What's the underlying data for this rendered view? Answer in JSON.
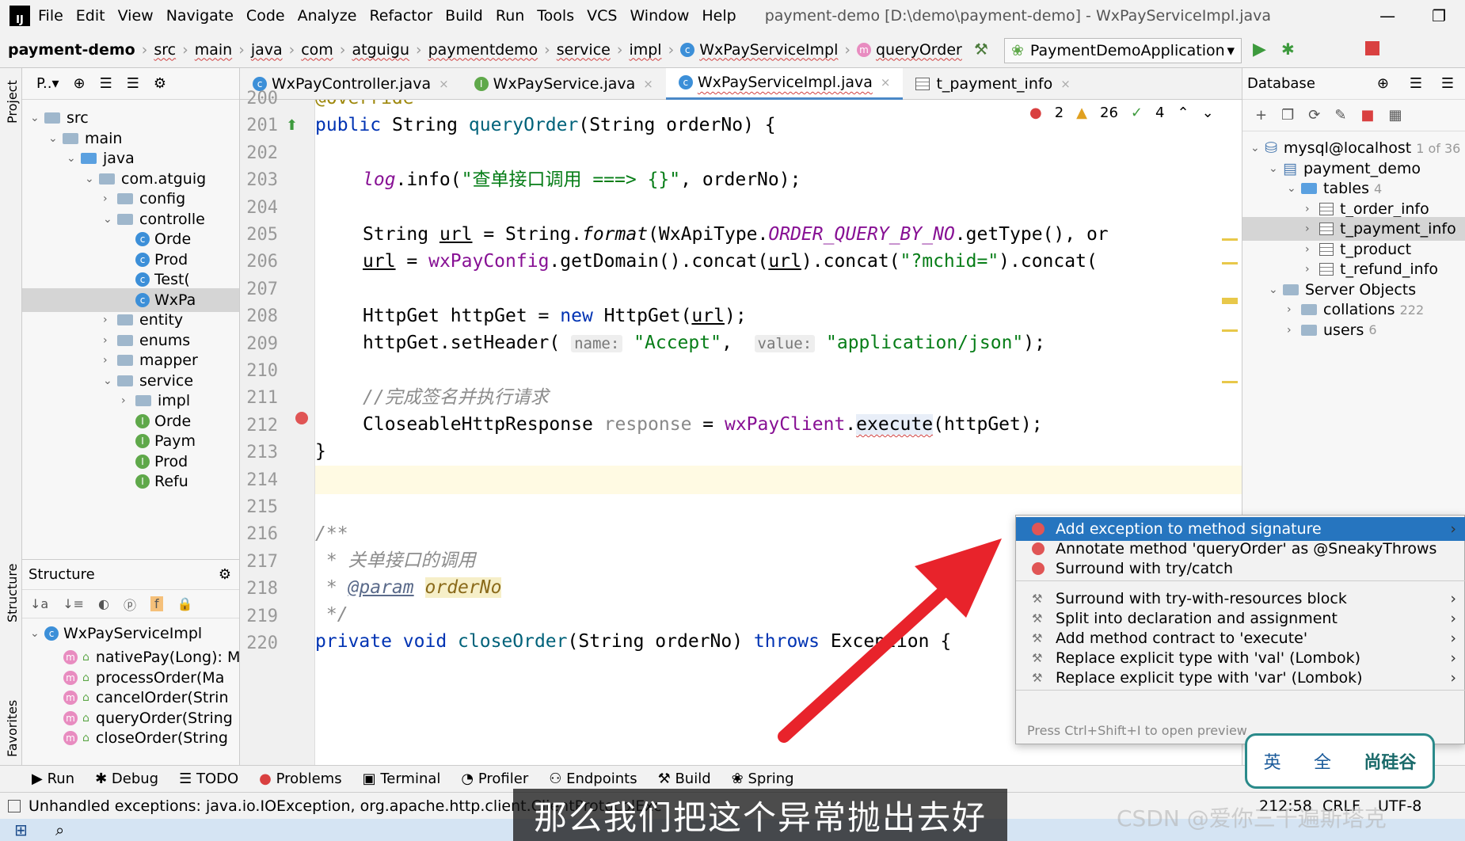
{
  "menu": {
    "items": [
      "File",
      "Edit",
      "View",
      "Navigate",
      "Code",
      "Analyze",
      "Refactor",
      "Build",
      "Run",
      "Tools",
      "VCS",
      "Window",
      "Help"
    ],
    "window_title": "payment-demo [D:\\demo\\payment-demo] - WxPayServiceImpl.java"
  },
  "navbar": {
    "crumbs": [
      "payment-demo",
      "src",
      "main",
      "java",
      "com",
      "atguigu",
      "paymentdemo",
      "service",
      "impl",
      "WxPayServiceImpl",
      "queryOrder"
    ],
    "run_config": "PaymentDemoApplication"
  },
  "project": {
    "header": "P..▾",
    "rows": [
      {
        "label": "src",
        "indent": 1,
        "chev": "⌄",
        "kind": "folder"
      },
      {
        "label": "main",
        "indent": 2,
        "chev": "⌄",
        "kind": "folder"
      },
      {
        "label": "java",
        "indent": 3,
        "chev": "⌄",
        "kind": "folder-blue"
      },
      {
        "label": "com.atguig",
        "indent": 4,
        "chev": "⌄",
        "kind": "folder"
      },
      {
        "label": "config",
        "indent": 5,
        "chev": "›",
        "kind": "folder"
      },
      {
        "label": "controlle",
        "indent": 5,
        "chev": "⌄",
        "kind": "folder"
      },
      {
        "label": "Orde",
        "indent": 6,
        "chev": "",
        "kind": "c"
      },
      {
        "label": "Prod",
        "indent": 6,
        "chev": "",
        "kind": "c"
      },
      {
        "label": "Test(",
        "indent": 6,
        "chev": "",
        "kind": "c"
      },
      {
        "label": "WxPa",
        "indent": 6,
        "chev": "",
        "kind": "c",
        "selected": true
      },
      {
        "label": "entity",
        "indent": 5,
        "chev": "›",
        "kind": "folder"
      },
      {
        "label": "enums",
        "indent": 5,
        "chev": "›",
        "kind": "folder"
      },
      {
        "label": "mapper",
        "indent": 5,
        "chev": "›",
        "kind": "folder"
      },
      {
        "label": "service",
        "indent": 5,
        "chev": "⌄",
        "kind": "folder"
      },
      {
        "label": "impl",
        "indent": 6,
        "chev": "›",
        "kind": "folder"
      },
      {
        "label": "Orde",
        "indent": 6,
        "chev": "",
        "kind": "i"
      },
      {
        "label": "Paym",
        "indent": 6,
        "chev": "",
        "kind": "i"
      },
      {
        "label": "Prod",
        "indent": 6,
        "chev": "",
        "kind": "i"
      },
      {
        "label": "Refu",
        "indent": 6,
        "chev": "",
        "kind": "i"
      }
    ]
  },
  "structure": {
    "title": "Structure",
    "root": "WxPayServiceImpl",
    "members": [
      "nativePay(Long): M",
      "processOrder(Ma",
      "cancelOrder(Strin",
      "queryOrder(String",
      "closeOrder(String"
    ]
  },
  "tabs": [
    {
      "label": "WxPayController.java",
      "icon": "c"
    },
    {
      "label": "WxPayService.java",
      "icon": "i"
    },
    {
      "label": "WxPayServiceImpl.java",
      "icon": "c",
      "active": true
    },
    {
      "label": "t_payment_info",
      "icon": "table"
    }
  ],
  "editor": {
    "line_numbers": [
      "200",
      "201",
      "202",
      "203",
      "204",
      "205",
      "206",
      "207",
      "208",
      "209",
      "210",
      "211",
      "212",
      "213",
      "214",
      "215",
      "216",
      "217",
      "218",
      "219",
      "220"
    ],
    "inspections": {
      "errors": "2",
      "warnings": "26",
      "typos": "4"
    },
    "code": {
      "l200": "@Override",
      "l201_kw": "public",
      "l201_type": " String ",
      "l201_fn": "queryOrder",
      "l201_rest": "(String orderNo) {",
      "l203_log": "log",
      "l203_a": ".info(",
      "l203_str": "\"查单接口调用 ===> {}\"",
      "l203_b": ", orderNo);",
      "l205_a": "String ",
      "l205_url": "url",
      "l205_b": " = String.",
      "l205_fmt": "format",
      "l205_c": "(WxApiType.",
      "l205_const": "ORDER_QUERY_BY_NO",
      "l205_d": ".getType(), or",
      "l206_url": "url",
      "l206_a": " = ",
      "l206_field": "wxPayConfig",
      "l206_b": ".getDomain().concat(",
      "l206_url2": "url",
      "l206_c": ").concat(",
      "l206_str": "\"?mchid=\"",
      "l206_d": ").concat(",
      "l208_a": "HttpGet httpGet = ",
      "l208_new": "new",
      "l208_b": " HttpGet(",
      "l208_url": "url",
      "l208_c": ");",
      "l209_a": "httpGet.setHeader(",
      "l209_hint1": "name:",
      "l209_str1": "\"Accept\"",
      "l209_b": ",",
      "l209_hint2": "value:",
      "l209_str2": "\"application/json\"",
      "l209_c": ");",
      "l211": "//完成签名并执行请求",
      "l212_a": "CloseableHttpResponse ",
      "l212_var": "response",
      "l212_b": " = ",
      "l212_field": "wxPayClient",
      "l212_c": ".",
      "l212_exec": "execute",
      "l212_d": "(httpGet);",
      "l213": "}",
      "l216": "/**",
      "l217": " * 关单接口的调用",
      "l218_a": " * ",
      "l218_param": "@param",
      "l218_b": " ",
      "l218_name": "orderNo",
      "l219": " */",
      "l220_kw": "private",
      "l220_void": " void ",
      "l220_fn": "closeOrder",
      "l220_rest": "(String orderNo) ",
      "l220_throws": "throws",
      "l220_end": " Exception {"
    }
  },
  "popup": {
    "items": [
      {
        "label": "Add exception to method signature",
        "icon": "error",
        "selected": true,
        "arrow": "›"
      },
      {
        "label": "Annotate method 'queryOrder' as @SneakyThrows",
        "icon": "error"
      },
      {
        "label": "Surround with try/catch",
        "icon": "error"
      },
      {
        "label": "Surround with try-with-resources block",
        "icon": "wrench",
        "arrow": "›"
      },
      {
        "label": "Split into declaration and assignment",
        "icon": "wrench",
        "arrow": "›"
      },
      {
        "label": "Add method contract to 'execute'",
        "icon": "wrench",
        "arrow": "›"
      },
      {
        "label": "Replace explicit type with 'val' (Lombok)",
        "icon": "wrench",
        "arrow": "›"
      },
      {
        "label": "Replace explicit type with 'var' (Lombok)",
        "icon": "wrench",
        "arrow": "›"
      }
    ],
    "footer": "Press Ctrl+Shift+I to open preview"
  },
  "database": {
    "title": "Database",
    "rows": [
      {
        "label": "mysql@localhost",
        "indent": 0,
        "chev": "⌄",
        "kind": "server",
        "count": "1 of 36"
      },
      {
        "label": "payment_demo",
        "indent": 1,
        "chev": "⌄",
        "kind": "schema"
      },
      {
        "label": "tables",
        "indent": 2,
        "chev": "⌄",
        "kind": "folder-blue",
        "count": "4"
      },
      {
        "label": "t_order_info",
        "indent": 3,
        "chev": "›",
        "kind": "table"
      },
      {
        "label": "t_payment_info",
        "indent": 3,
        "chev": "›",
        "kind": "table",
        "selected": true
      },
      {
        "label": "t_product",
        "indent": 3,
        "chev": "›",
        "kind": "table"
      },
      {
        "label": "t_refund_info",
        "indent": 3,
        "chev": "›",
        "kind": "table"
      },
      {
        "label": "Server Objects",
        "indent": 1,
        "chev": "⌄",
        "kind": "folder"
      },
      {
        "label": "collations",
        "indent": 2,
        "chev": "›",
        "kind": "folder",
        "count": "222"
      },
      {
        "label": "users",
        "indent": 2,
        "chev": "›",
        "kind": "folder",
        "count": "6"
      }
    ]
  },
  "toolwindows": [
    "Run",
    "Debug",
    "TODO",
    "Problems",
    "Terminal",
    "Profiler",
    "Endpoints",
    "Build",
    "Spring"
  ],
  "status": {
    "message": "Unhandled exceptions: java.io.IOException, org.apache.http.client.ClientProtocolExc",
    "position": "212:58",
    "line_sep": "CRLF",
    "encoding": "UTF-8"
  },
  "subtitle": "那么我们把这个异常抛出去好",
  "watermark": "CSDN @爱你三千遍斯塔克",
  "ime": {
    "lang": "英",
    "full": "全",
    "brand": "尚硅谷"
  },
  "left_stripe": {
    "project": "Project",
    "structure": "Structure",
    "favorites": "Favorites"
  },
  "colors": {
    "selection": "#2675bf",
    "accent": "#4a88c7",
    "arrow": "#e8232b"
  }
}
